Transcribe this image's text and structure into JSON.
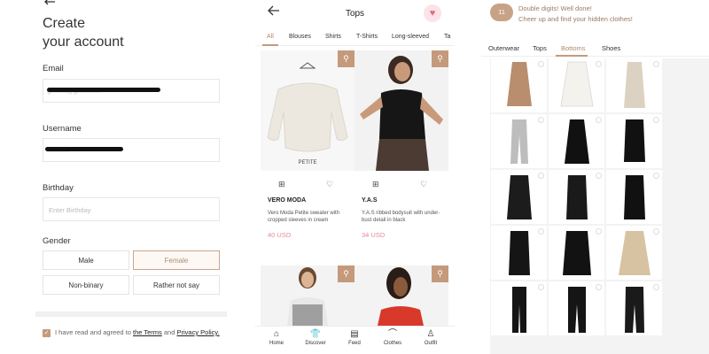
{
  "signup": {
    "title_line1": "Create",
    "title_line2": "your account",
    "email_label": "Email",
    "email_value": "g.......l@g.........m",
    "username_label": "Username",
    "username_value": "...........",
    "birthday_label": "Birthday",
    "birthday_placeholder": "Enter Birthday",
    "gender_label": "Gender",
    "gender_options": [
      "Male",
      "Female",
      "Non-binary",
      "Rather not say"
    ],
    "selected_gender": "Female",
    "agree_text": "I have read and agreed to",
    "terms_link": "the Terms",
    "and_text": "and",
    "privacy_link": "Privacy Policy."
  },
  "tops": {
    "title": "Tops",
    "categories": [
      "All",
      "Blouses",
      "Shirts",
      "T-Shirts",
      "Long-sleeved",
      "Ta"
    ],
    "active_category": "All",
    "products": [
      {
        "tag": "PETITE",
        "brand": "VERO MODA",
        "desc": "Vero Moda Petite sweater with cropped sleeves in cream",
        "price": "40 USD"
      },
      {
        "tag": "",
        "brand": "Y.A.S",
        "desc": "Y.A.S ribbed bodysuit with under-bust detail in black",
        "price": "34 USD"
      }
    ],
    "nav": [
      "Home",
      "Discover",
      "Feed",
      "Clothes",
      "Outfit"
    ],
    "active_nav": "Discover"
  },
  "closet": {
    "count": "11",
    "message_line1": "Double digits! Well done!",
    "message_line2": "Cheer up and find your hidden clothes!",
    "tabs": [
      "Outerwear",
      "Tops",
      "Bottoms",
      "Shoes"
    ],
    "active_tab": "Bottoms"
  },
  "colors": {
    "accent": "#c49a7b",
    "price": "#e8899a",
    "heart_bg": "#fbe3e8"
  }
}
